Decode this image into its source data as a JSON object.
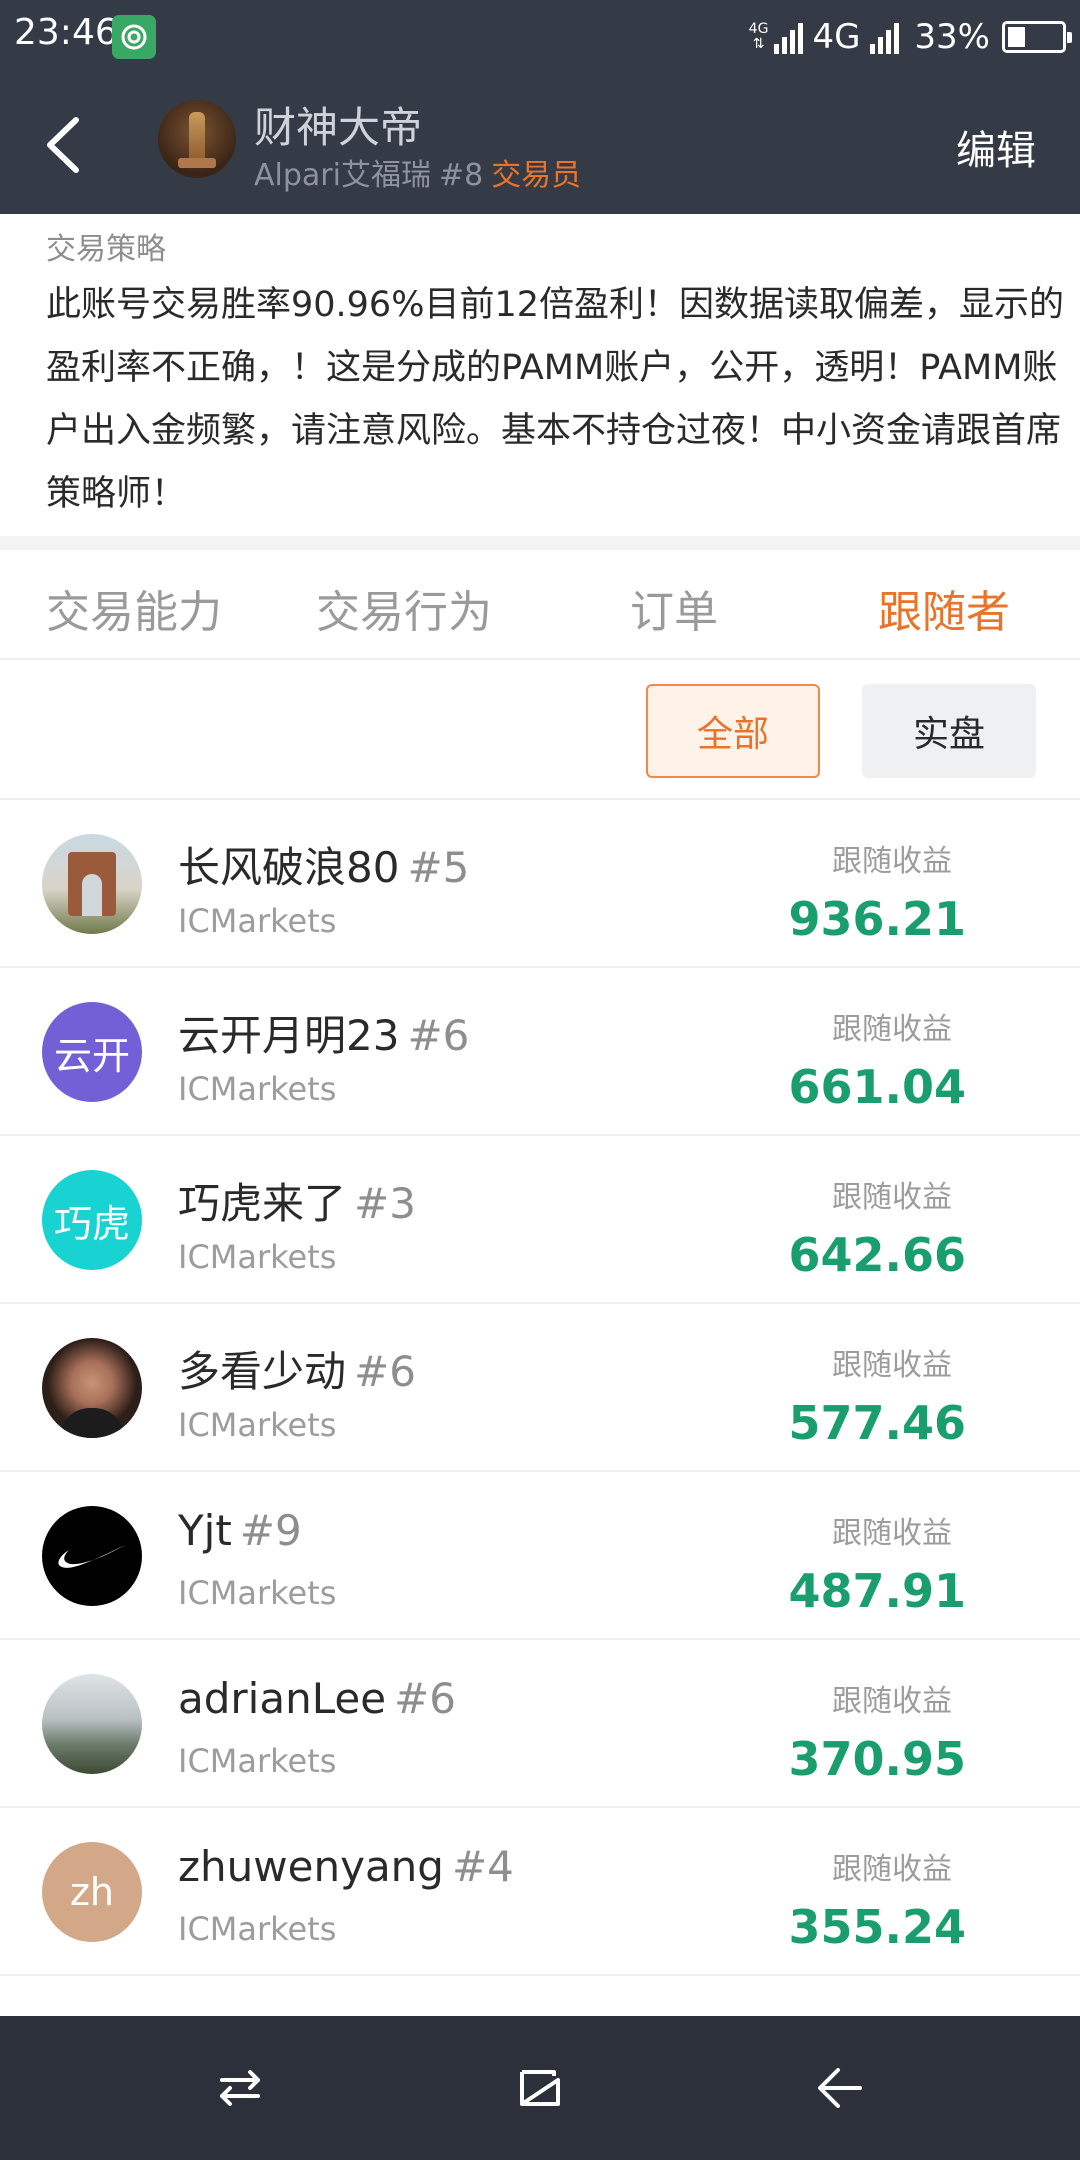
{
  "status_bar": {
    "time": "23:46",
    "network_small": "4G",
    "network_label": "4G",
    "battery_percent": "33%",
    "battery_level": 0.33,
    "colors": {
      "background": "#343a46",
      "app_icon": "#3aa865"
    }
  },
  "header": {
    "name": "财神大帝",
    "broker": "Alpari艾福瑞",
    "rank": "#8",
    "role": "交易员",
    "edit_label": "编辑",
    "colors": {
      "role": "#e8742a"
    }
  },
  "strategy": {
    "title": "交易策略",
    "text": "此账号交易胜率90.96%目前12倍盈利！因数据读取偏差，显示的盈利率不正确，！这是分成的PAMM账户，公开，透明！PAMM账户出入金频繁，请注意风险。基本不持仓过夜！中小资金请跟首席策略师！"
  },
  "tabs": [
    {
      "label": "交易能力",
      "active": false
    },
    {
      "label": "交易行为",
      "active": false
    },
    {
      "label": "订单",
      "active": false
    },
    {
      "label": "跟随者",
      "active": true
    }
  ],
  "filters": {
    "all": "全部",
    "live": "实盘",
    "selected": "all"
  },
  "followers": [
    {
      "name": "长风破浪80",
      "rank": "#5",
      "broker": "ICMarkets",
      "label": "跟随收益",
      "value": "936.21",
      "avatar": "arch-photo"
    },
    {
      "name": "云开月明23",
      "rank": "#6",
      "broker": "ICMarkets",
      "label": "跟随收益",
      "value": "661.04",
      "avatar": "text-avatar",
      "avatar_text": "云开"
    },
    {
      "name": "巧虎来了",
      "rank": "#3",
      "broker": "ICMarkets",
      "label": "跟随收益",
      "value": "642.66",
      "avatar": "text-avatar",
      "avatar_text": "巧虎"
    },
    {
      "name": "多看少动",
      "rank": "#6",
      "broker": "ICMarkets",
      "label": "跟随收益",
      "value": "577.46",
      "avatar": "portrait-photo"
    },
    {
      "name": "Yjt",
      "rank": "#9",
      "broker": "ICMarkets",
      "label": "跟随收益",
      "value": "487.91",
      "avatar": "nike-logo"
    },
    {
      "name": "adrianLee",
      "rank": "#6",
      "broker": "ICMarkets",
      "label": "跟随收益",
      "value": "370.95",
      "avatar": "mountain-photo"
    },
    {
      "name": "zhuwenyang",
      "rank": "#4",
      "broker": "ICMarkets",
      "label": "跟随收益",
      "value": "355.24",
      "avatar": "text-avatar",
      "avatar_text": "zh"
    }
  ],
  "colors": {
    "accent": "#e8742a",
    "profit": "#1a9e6e",
    "nav_bar": "#2b303a"
  },
  "nav_bar": {
    "icons": [
      "switch-apps-icon",
      "home-square-icon",
      "back-arrow-icon"
    ]
  }
}
